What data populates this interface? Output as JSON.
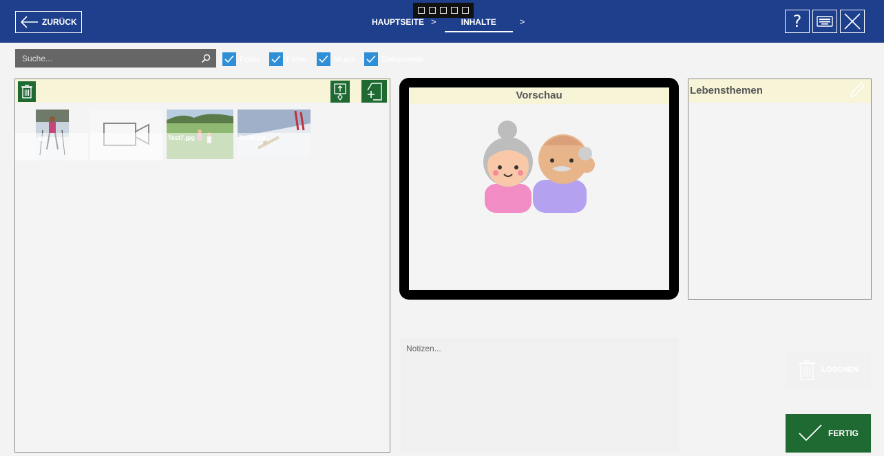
{
  "header": {
    "back_label": "ZURÜCK",
    "breadcrumb": [
      {
        "label": "HAUPTSEITE"
      },
      {
        "label": "INHALTE"
      }
    ],
    "separator": ">",
    "icons": [
      "help-icon",
      "keyboard-icon",
      "close-icon"
    ],
    "help_glyph": "?"
  },
  "filters": {
    "search_placeholder": "Suche...",
    "checkboxes": [
      {
        "label": "Fotos",
        "checked": true
      },
      {
        "label": "Filme",
        "checked": true
      },
      {
        "label": "Musik",
        "checked": true
      },
      {
        "label": "Dokumente",
        "checked": true
      }
    ]
  },
  "media": {
    "items": [
      {
        "label": ".jpg",
        "type": "image"
      },
      {
        "label": "",
        "type": "video"
      },
      {
        "label": "Test7.jpg",
        "type": "image"
      },
      {
        "label": "Test8.jpg",
        "type": "image"
      }
    ]
  },
  "preview": {
    "title": "Vorschau"
  },
  "themes": {
    "title": "Lebensthemen"
  },
  "notes": {
    "placeholder": "Notizen..."
  },
  "actions": {
    "delete_label": "LÖSCHEN",
    "done_label": "FERTIG"
  },
  "colors": {
    "header_bg": "#1d3f8c",
    "green": "#1e6a32",
    "checkbox": "#2f8fd6",
    "panel_header": "#f7f4d8"
  }
}
